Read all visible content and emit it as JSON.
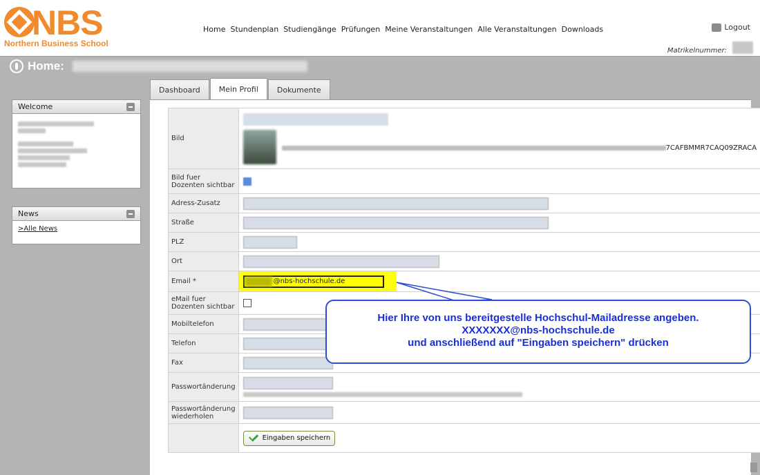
{
  "brand": {
    "name": "NBS",
    "subtitle": "Northern Business School",
    "accent": "#f08a2c"
  },
  "nav": {
    "items": [
      "Home",
      "Stundenplan",
      "Studiengänge",
      "Prüfungen",
      "Meine Veranstaltungen",
      "Alle Veranstaltungen",
      "Downloads"
    ]
  },
  "account": {
    "logout_label": "Logout",
    "matrikel_label": "Matrikelnummer:"
  },
  "page": {
    "title": "Home:"
  },
  "sidebar": {
    "welcome_title": "Welcome",
    "news_title": "News",
    "news_link": ">Alle News"
  },
  "tabs": [
    {
      "label": "Dashboard"
    },
    {
      "label": "Mein Profil"
    },
    {
      "label": "Dokumente"
    }
  ],
  "form": {
    "labels": {
      "bild": "Bild",
      "bild_sichtbar": "Bild fuer Dozenten sichtbar",
      "adresszusatz": "Adress-Zusatz",
      "strasse": "Straße",
      "plz": "PLZ",
      "ort": "Ort",
      "email": "Email *",
      "email_sichtbar": "eMail fuer Dozenten sichtbar",
      "mobil": "Mobiltelefon",
      "telefon": "Telefon",
      "fax": "Fax",
      "passwort": "Passwortänderung",
      "passwort_wdh": "Passwortänderung wiederholen"
    },
    "image_code_tail": "7CAFBMMR7CAQ09ZRACA",
    "email_value": "@nbs-hochschule.de",
    "save_label": "Eingaben speichern"
  },
  "callout": {
    "line1": "Hier Ihre von uns bereitgestelle Hochschul-Mailadresse angeben.",
    "line2": "XXXXXXX@nbs-hochschule.de",
    "line3": "und anschließend auf \"Eingaben speichern\" drücken",
    "color": "#1a2fd1"
  }
}
